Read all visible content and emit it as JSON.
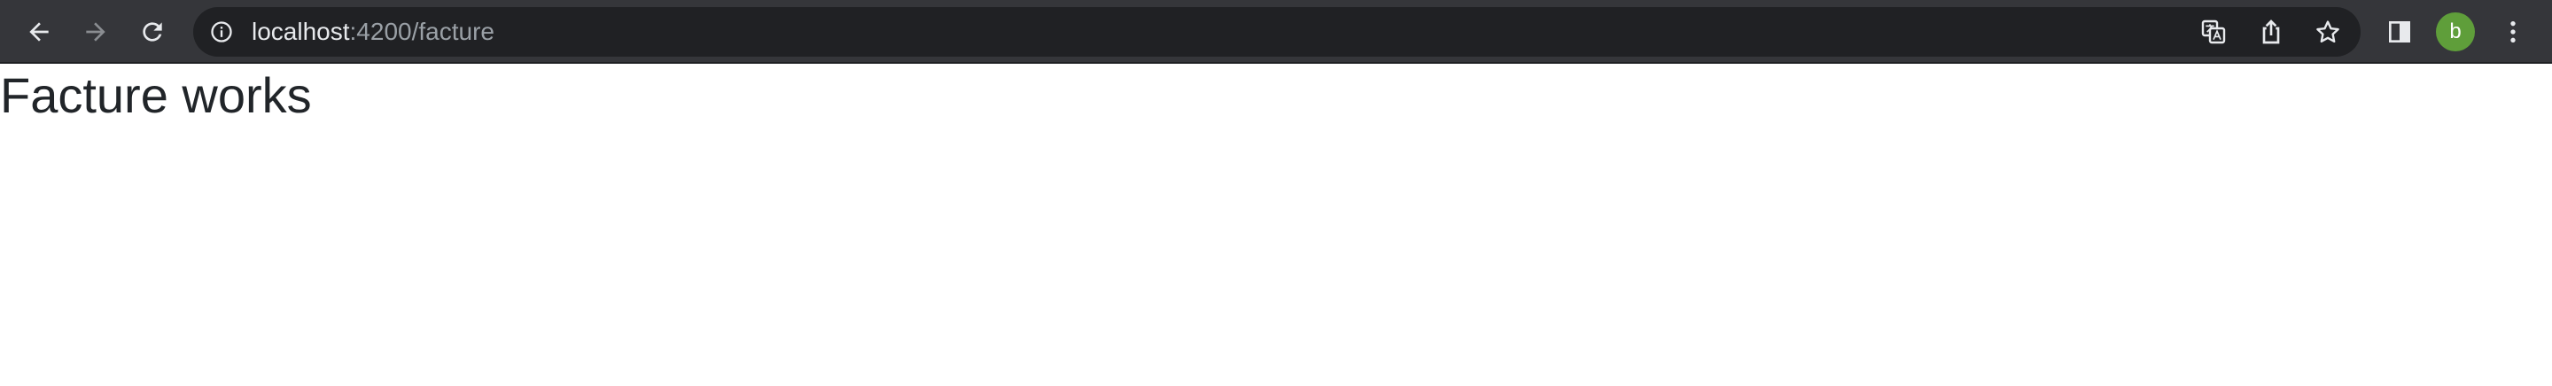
{
  "browser": {
    "url_host": "localhost",
    "url_path": ":4200/facture",
    "profile_initial": "b",
    "icons": [
      "back-icon",
      "forward-icon",
      "reload-icon",
      "site-info-icon",
      "translate-icon",
      "share-icon",
      "bookmark-star-icon",
      "side-panel-icon",
      "menu-icon"
    ],
    "colors": {
      "toolbar": "#35363a",
      "omnibox": "#202124",
      "avatar": "#5f9e3a"
    }
  },
  "page": {
    "heading": "Facture works"
  }
}
